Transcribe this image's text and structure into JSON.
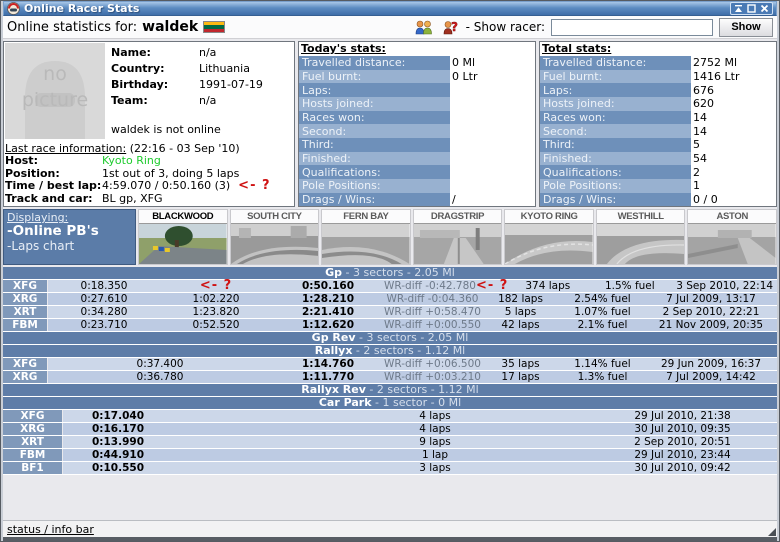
{
  "window": {
    "title": "Online Racer Stats",
    "status_bar": "status / info bar"
  },
  "icons": {
    "app": "helmet-icon",
    "window_controls": [
      "shade",
      "maximize",
      "close"
    ],
    "racers_list": "two-people-icon",
    "find_racer": "person-question-icon",
    "flag": "lithuania-flag"
  },
  "colors": {
    "titlebar": "#5d8cc2",
    "section_bar": "#5e7da8",
    "stat_label_dark": "#6e90ba",
    "stat_label_light": "#98b1d0",
    "row_light": "#ccd7e9",
    "row_dark": "#bdcbe3",
    "car_cell": "#8099ba",
    "host_green": "#1ecb2e",
    "annotation_red": "#cf1212",
    "flag_yellow": "#fdb913",
    "flag_green": "#006a44",
    "flag_red": "#c1272d"
  },
  "header": {
    "prefix": "Online statistics for:",
    "racer": "waldek",
    "show_racer_label": "- Show racer:",
    "input_value": "",
    "show_button": "Show"
  },
  "profile": {
    "no_picture_line1": "no",
    "no_picture_line2": "picture",
    "fields": [
      {
        "label": "Name:",
        "value": "n/a"
      },
      {
        "label": "Country:",
        "value": "Lithuania"
      },
      {
        "label": "Birthday:",
        "value": "1991-07-19"
      },
      {
        "label": "Team:",
        "value": "n/a"
      }
    ],
    "offline_text": "waldek is not online",
    "last_race": {
      "title": "Last race information:",
      "timestamp": "(22:16 - 03 Sep '10)",
      "rows": [
        {
          "label": "Host:",
          "value": "Kyoto Ring"
        },
        {
          "label": "Position:",
          "value": "1st out of 3, doing 5 laps"
        },
        {
          "label": "Time / best lap:",
          "value": "4:59.070 / 0:50.160 (3)"
        },
        {
          "label": "Track and car:",
          "value": "BL gp, XFG"
        }
      ]
    }
  },
  "annotations": {
    "arrow_question": "<- ?"
  },
  "today_stats": {
    "title": "Today's stats:",
    "rows": [
      {
        "label": "Travelled distance:",
        "value": "0 Ml"
      },
      {
        "label": "Fuel burnt:",
        "value": "0 Ltr"
      },
      {
        "label": "Laps:",
        "value": ""
      },
      {
        "label": "Hosts joined:",
        "value": ""
      },
      {
        "label": "Races won:",
        "value": ""
      },
      {
        "label": "Second:",
        "value": ""
      },
      {
        "label": "Third:",
        "value": ""
      },
      {
        "label": "Finished:",
        "value": ""
      },
      {
        "label": "Qualifications:",
        "value": ""
      },
      {
        "label": "Pole Positions:",
        "value": ""
      },
      {
        "label": "Drags / Wins:",
        "value": "/"
      }
    ]
  },
  "total_stats": {
    "title": "Total stats:",
    "rows": [
      {
        "label": "Travelled distance:",
        "value": "2752 Ml"
      },
      {
        "label": "Fuel burnt:",
        "value": "1416 Ltr"
      },
      {
        "label": "Laps:",
        "value": "676"
      },
      {
        "label": "Hosts joined:",
        "value": "620"
      },
      {
        "label": "Races won:",
        "value": "14"
      },
      {
        "label": "Second:",
        "value": "14"
      },
      {
        "label": "Third:",
        "value": "5"
      },
      {
        "label": "Finished:",
        "value": "54"
      },
      {
        "label": "Qualifications:",
        "value": "2"
      },
      {
        "label": "Pole Positions:",
        "value": "1"
      },
      {
        "label": "Drags / Wins:",
        "value": "0 / 0"
      }
    ]
  },
  "displaying": {
    "title": "Displaying:",
    "online_pbs": "-Online PB's",
    "laps_chart": "-Laps chart"
  },
  "tracks": [
    {
      "name": "BLACKWOOD",
      "selected": true
    },
    {
      "name": "SOUTH CITY",
      "selected": false
    },
    {
      "name": "FERN BAY",
      "selected": false
    },
    {
      "name": "DRAGSTRIP",
      "selected": false
    },
    {
      "name": "KYOTO RING",
      "selected": false
    },
    {
      "name": "WESTHILL",
      "selected": false
    },
    {
      "name": "ASTON",
      "selected": false
    }
  ],
  "pb": {
    "headers": [
      {
        "name": "Gp",
        "info": " - 3 sectors - 2.05 Ml"
      },
      {
        "name": "Gp Rev",
        "info": " - 3 sectors - 2.05 Ml"
      },
      {
        "name": "Rallyx",
        "info": " - 2 sectors - 1.12 Ml"
      },
      {
        "name": "Rallyx Rev",
        "info": " - 2 sectors - 1.12 Ml"
      },
      {
        "name": "Car Park",
        "info": " - 1 sector - 0 Ml"
      }
    ],
    "gp_rows": [
      {
        "car": "XFG",
        "s1": "0:18.350",
        "s2": "",
        "lap": "0:50.160",
        "wr": "WR-diff -0:42.780",
        "laps": "374 laps",
        "fuel": "1.5% fuel",
        "date": "3 Sep 2010, 22:14"
      },
      {
        "car": "XRG",
        "s1": "0:27.610",
        "s2": "1:02.220",
        "lap": "1:28.210",
        "wr": "WR-diff -0:04.360",
        "laps": "182 laps",
        "fuel": "2.54% fuel",
        "date": "7 Jul 2009, 13:17"
      },
      {
        "car": "XRT",
        "s1": "0:34.280",
        "s2": "1:23.820",
        "lap": "2:21.410",
        "wr": "WR-diff +0:58.470",
        "laps": "5 laps",
        "fuel": "1.07% fuel",
        "date": "2 Sep 2010, 22:21"
      },
      {
        "car": "FBM",
        "s1": "0:23.710",
        "s2": "0:52.520",
        "lap": "1:12.620",
        "wr": "WR-diff +0:00.550",
        "laps": "42 laps",
        "fuel": "2.1% fuel",
        "date": "21 Nov 2009, 20:35"
      }
    ],
    "rallyx_rows": [
      {
        "car": "XFG",
        "split": "0:37.400",
        "lap": "1:14.760",
        "wr": "WR-diff +0:06.500",
        "laps": "35 laps",
        "fuel": "1.14% fuel",
        "date": "29 Jun 2009, 16:37"
      },
      {
        "car": "XRG",
        "split": "0:36.780",
        "lap": "1:11.770",
        "wr": "WR-diff +0:03.210",
        "laps": "17 laps",
        "fuel": "1.3% fuel",
        "date": "7 Jul 2009, 14:42"
      }
    ],
    "carpark_rows": [
      {
        "car": "XFG",
        "time": "0:17.040",
        "laps": "4 laps",
        "date": "29 Jul 2010, 21:38"
      },
      {
        "car": "XRG",
        "time": "0:16.170",
        "laps": "4 laps",
        "date": "30 Jul 2010, 09:35"
      },
      {
        "car": "XRT",
        "time": "0:13.990",
        "laps": "9 laps",
        "date": "2 Sep 2010, 20:51"
      },
      {
        "car": "FBM",
        "time": "0:44.910",
        "laps": "1 lap",
        "date": "29 Jul 2010, 23:44"
      },
      {
        "car": "BF1",
        "time": "0:10.550",
        "laps": "3 laps",
        "date": "30 Jul 2010, 09:42"
      }
    ]
  }
}
